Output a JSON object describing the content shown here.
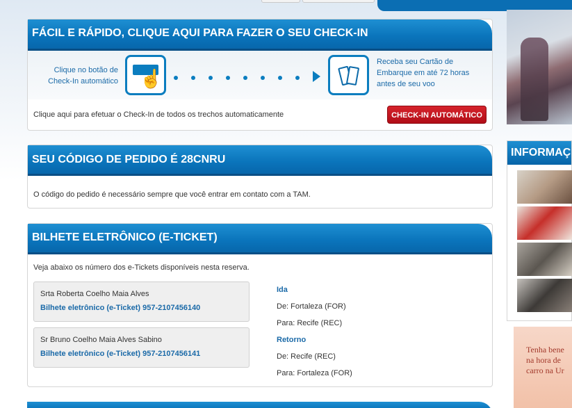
{
  "checkin": {
    "title": "FÁCIL E RÁPIDO, CLIQUE AQUI PARA FAZER O SEU CHECK-IN",
    "left_text": "Clique no botão de Check-In automático",
    "right_text": "Receba seu Cartão de Embarque em até 72 horas antes de seu voo",
    "all_segments_text": "Clique aqui para efetuar o Check-In de todos os trechos automaticamente",
    "button_label": "CHECK-IN AUTOMÁTICO",
    "icons": [
      "button-press-icon",
      "boarding-pass-icon"
    ]
  },
  "order": {
    "title": "SEU CÓDIGO DE PEDIDO É 28CNRU",
    "note": "O código do pedido é necessário sempre que você entrar em contato com a TAM."
  },
  "eticket": {
    "title": "BILHETE ELETRÔNICO (E-TICKET)",
    "intro": "Veja abaixo os número dos e-Tickets disponíveis nesta reserva.",
    "passengers": [
      {
        "name": "Srta Roberta Coelho Maia Alves",
        "ticket": "Bilhete eletrônico (e-Ticket) 957-2107456140"
      },
      {
        "name": "Sr Bruno Coelho Maia Alves Sabino",
        "ticket": "Bilhete eletrônico (e-Ticket) 957-2107456141"
      }
    ],
    "outbound": {
      "label": "Ida",
      "from": "De: Fortaleza (FOR)",
      "to": "Para: Recife (REC)"
    },
    "return": {
      "label": "Retorno",
      "from": "De: Recife (REC)",
      "to": "Para: Fortaleza (FOR)"
    }
  },
  "sidebar": {
    "info_title": "INFORMAÇ",
    "ad_lines": [
      "Tenha bene",
      "na hora de",
      "carro na Ur"
    ]
  },
  "colors": {
    "header_blue": "#0a74bb",
    "link_blue": "#1b6aa8",
    "button_red": "#c41820"
  }
}
